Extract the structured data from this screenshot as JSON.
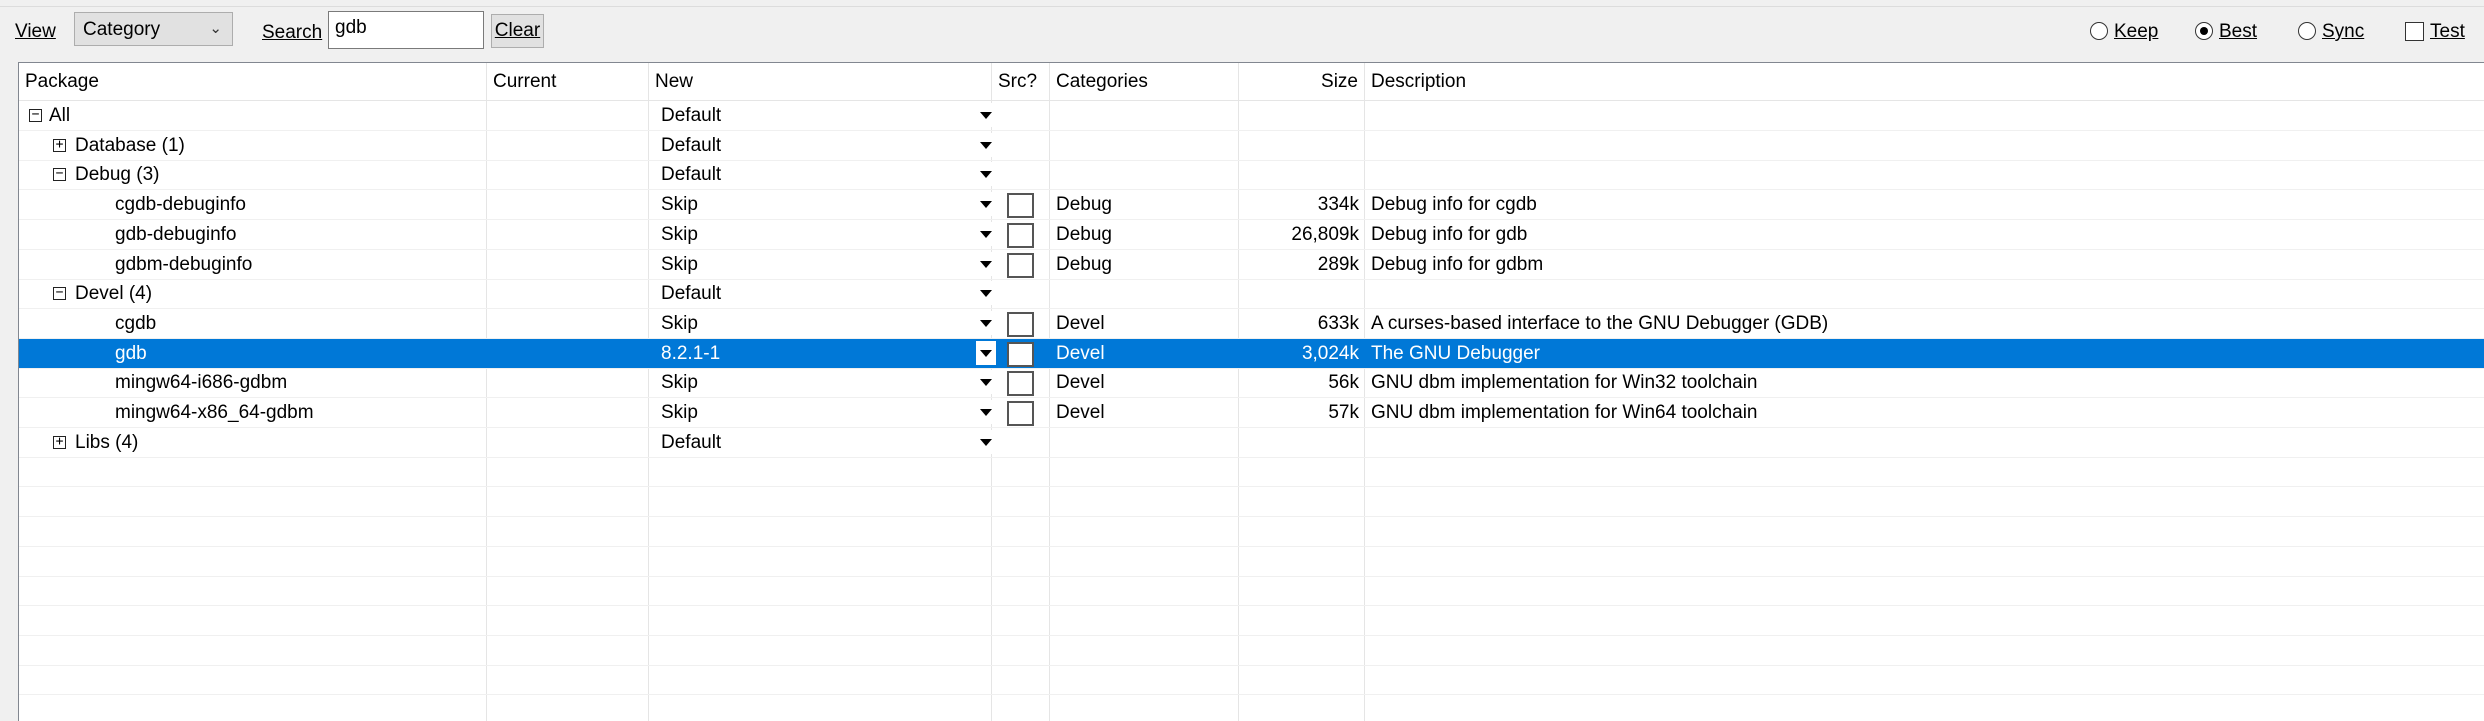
{
  "toolbar": {
    "view_label": "View",
    "view_value": "Category",
    "search_label": "Search",
    "search_value": "gdb",
    "clear_label": "Clear",
    "keep_label": "Keep",
    "best_label": "Best",
    "sync_label": "Sync",
    "test_label": "Test",
    "selected_mode": "Best"
  },
  "columns": {
    "package": "Package",
    "current": "Current",
    "new": "New",
    "src": "Src?",
    "categories": "Categories",
    "size": "Size",
    "description": "Description"
  },
  "rows": [
    {
      "package": "All",
      "indent": 0,
      "expander": "minus",
      "current": "",
      "new": "Default",
      "src": false,
      "category": "",
      "size": "",
      "description": ""
    },
    {
      "package": "Database (1)",
      "indent": 1,
      "expander": "plus",
      "current": "",
      "new": "Default",
      "src": false,
      "category": "",
      "size": "",
      "description": ""
    },
    {
      "package": "Debug (3)",
      "indent": 1,
      "expander": "minus",
      "current": "",
      "new": "Default",
      "src": false,
      "category": "",
      "size": "",
      "description": ""
    },
    {
      "package": "cgdb-debuginfo",
      "indent": 2,
      "expander": "",
      "current": "",
      "new": "Skip",
      "src": true,
      "category": "Debug",
      "size": "334k",
      "description": "Debug info for cgdb"
    },
    {
      "package": "gdb-debuginfo",
      "indent": 2,
      "expander": "",
      "current": "",
      "new": "Skip",
      "src": true,
      "category": "Debug",
      "size": "26,809k",
      "description": "Debug info for gdb"
    },
    {
      "package": "gdbm-debuginfo",
      "indent": 2,
      "expander": "",
      "current": "",
      "new": "Skip",
      "src": true,
      "category": "Debug",
      "size": "289k",
      "description": "Debug info for gdbm"
    },
    {
      "package": "Devel (4)",
      "indent": 1,
      "expander": "minus",
      "current": "",
      "new": "Default",
      "src": false,
      "category": "",
      "size": "",
      "description": ""
    },
    {
      "package": "cgdb",
      "indent": 2,
      "expander": "",
      "current": "",
      "new": "Skip",
      "src": true,
      "category": "Devel",
      "size": "633k",
      "description": "A curses-based interface to the GNU Debugger (GDB)"
    },
    {
      "package": "gdb",
      "indent": 2,
      "expander": "",
      "current": "",
      "new": "8.2.1-1",
      "src": true,
      "category": "Devel",
      "size": "3,024k",
      "description": "The GNU Debugger",
      "selected": true
    },
    {
      "package": "mingw64-i686-gdbm",
      "indent": 2,
      "expander": "",
      "current": "",
      "new": "Skip",
      "src": true,
      "category": "Devel",
      "size": "56k",
      "description": "GNU dbm implementation for Win32 toolchain"
    },
    {
      "package": "mingw64-x86_64-gdbm",
      "indent": 2,
      "expander": "",
      "current": "",
      "new": "Skip",
      "src": true,
      "category": "Devel",
      "size": "57k",
      "description": "GNU dbm implementation for Win64 toolchain"
    },
    {
      "package": "Libs (4)",
      "indent": 1,
      "expander": "plus",
      "current": "",
      "new": "Default",
      "src": false,
      "category": "",
      "size": "",
      "description": ""
    }
  ]
}
